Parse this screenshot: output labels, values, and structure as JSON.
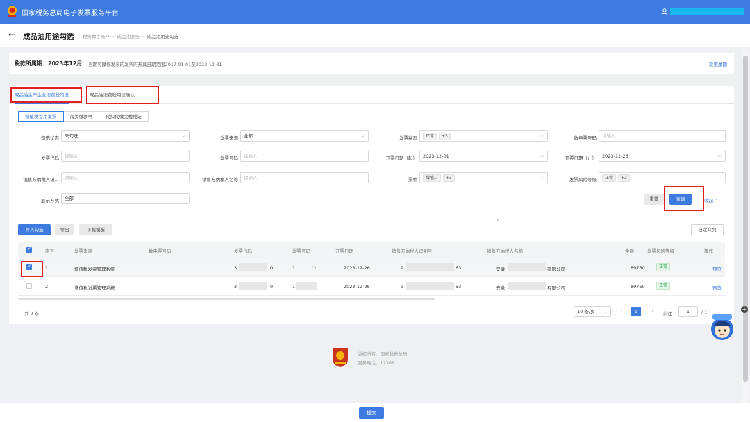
{
  "app": {
    "title": "国家税务总局电子发票服务平台"
  },
  "header": {
    "back_arrow": "←",
    "page_title": "成品油用途勾选",
    "breadcrumb": [
      "税务数字账户",
      "成品油业务",
      "成品油用途勾选"
    ],
    "breadcrumb_sep": "›"
  },
  "period": {
    "label": "税款所属期：2023年12月",
    "description": "当期可操作发票的发票的开具日期范围2017-01-01至2023-12-31",
    "change_link": "变更属期"
  },
  "tabs": [
    {
      "label": "成品油生产企业消费税勾选",
      "active": true
    },
    {
      "label": "成品油消费税用途确认",
      "active": false
    }
  ],
  "subtabs": [
    {
      "label": "增值税专用发票",
      "active": true
    },
    {
      "label": "海关缴款书",
      "active": false
    },
    {
      "label": "代扣代缴完税凭证",
      "active": false
    }
  ],
  "filters": {
    "check_status": {
      "label": "勾选状态",
      "value": "未勾选"
    },
    "invoice_source": {
      "label": "发票来源",
      "value": "全部"
    },
    "invoice_status": {
      "label": "发票状态",
      "tag": "正常",
      "more": "+3"
    },
    "digital_invoice_no": {
      "label": "数电票号码",
      "placeholder": "请输入"
    },
    "invoice_code": {
      "label": "发票代码",
      "placeholder": "请输入"
    },
    "invoice_no": {
      "label": "发票号码",
      "placeholder": "请输入"
    },
    "issue_date_start": {
      "label": "开票日期（起）",
      "value": "2023-12-01"
    },
    "issue_date_end": {
      "label": "开票日期（止）",
      "value": "2023-12-26"
    },
    "seller_tax_id": {
      "label": "销售方纳税人识...",
      "placeholder": "请输入"
    },
    "seller_name": {
      "label": "销售方纳税人名称",
      "placeholder": "请输入"
    },
    "ticket_type": {
      "label": "票种",
      "tag": "增值...",
      "more": "+3"
    },
    "risk_level": {
      "label": "发票风险等级",
      "tag": "正常",
      "more": "+2"
    },
    "display_mode": {
      "label": "展示方式",
      "value": "全部"
    }
  },
  "actions": {
    "reset": "重置",
    "query": "查询",
    "collapse": "收起",
    "import_check": "导入勾选",
    "export": "导出",
    "download_template": "下载模板",
    "custom_columns": "自定义列"
  },
  "table": {
    "columns": [
      "序号",
      "发票来源",
      "数电票号码",
      "发票代码",
      "发票号码",
      "开票日期",
      "销售方纳税人识别号",
      "销售方纳税人名称",
      "金额",
      "发票风险等级",
      "操作"
    ],
    "rows": [
      {
        "selected": true,
        "index": "1",
        "source": "增值税发票管理系统",
        "code_head": "3",
        "code_tail": "0",
        "no_head": "1",
        "no_tail": "'1",
        "date": "2023-12-26",
        "tax_head": "9",
        "tax_tail": "63",
        "name_head": "安徽",
        "name_tail": "有限公司",
        "amount": "89760",
        "risk": "正常",
        "op": "预览"
      },
      {
        "selected": false,
        "index": "2",
        "source": "增值税发票管理系统",
        "code_head": "3",
        "code_tail": "0",
        "no_head": "1",
        "no_tail": "",
        "date": "2023-12-26",
        "tax_head": "9",
        "tax_tail": "53",
        "name_head": "安徽",
        "name_tail": "有限公司",
        "amount": "89760",
        "risk": "正常",
        "op": "预览"
      }
    ]
  },
  "pager": {
    "total": "共 2 条",
    "page_size": "10 条/页",
    "current": "1",
    "goto_label": "前往",
    "goto_value": "1",
    "of": "/ 1"
  },
  "footer": {
    "copyright": "版权所有：国家税务总局",
    "phone": "服务电话：12366"
  },
  "submit": "提交",
  "colors": {
    "accent": "#3e7be0",
    "highlight": "#e02020",
    "ok": "#26a34a"
  }
}
